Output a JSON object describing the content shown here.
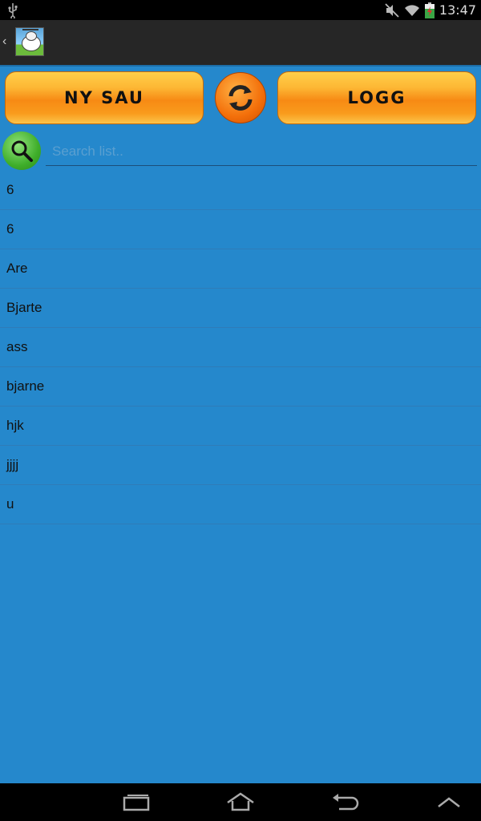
{
  "status_bar": {
    "time": "13:47",
    "icons": [
      "usb-icon",
      "mute-icon",
      "wifi-icon",
      "battery-icon"
    ]
  },
  "action_bar": {
    "back_icon": "chevron-left-icon",
    "app_icon": "sheep-helicopter-app-icon"
  },
  "toolbar": {
    "new_sheep_label": "NY SAU",
    "refresh_icon": "refresh-icon",
    "log_label": "LOGG"
  },
  "search": {
    "placeholder": "Search list..",
    "value": "",
    "icon": "search-icon"
  },
  "list": {
    "items": [
      "6",
      "6",
      "Are",
      "Bjarte",
      "ass",
      "bjarne",
      "hjk",
      "jjjj",
      "u"
    ]
  },
  "nav_bar": {
    "icons": [
      "recent-apps-icon",
      "home-icon",
      "back-icon",
      "menu-up-icon"
    ]
  },
  "colors": {
    "background": "#2588cc",
    "button_orange": "#f78a14",
    "search_green": "#3fae2a"
  }
}
